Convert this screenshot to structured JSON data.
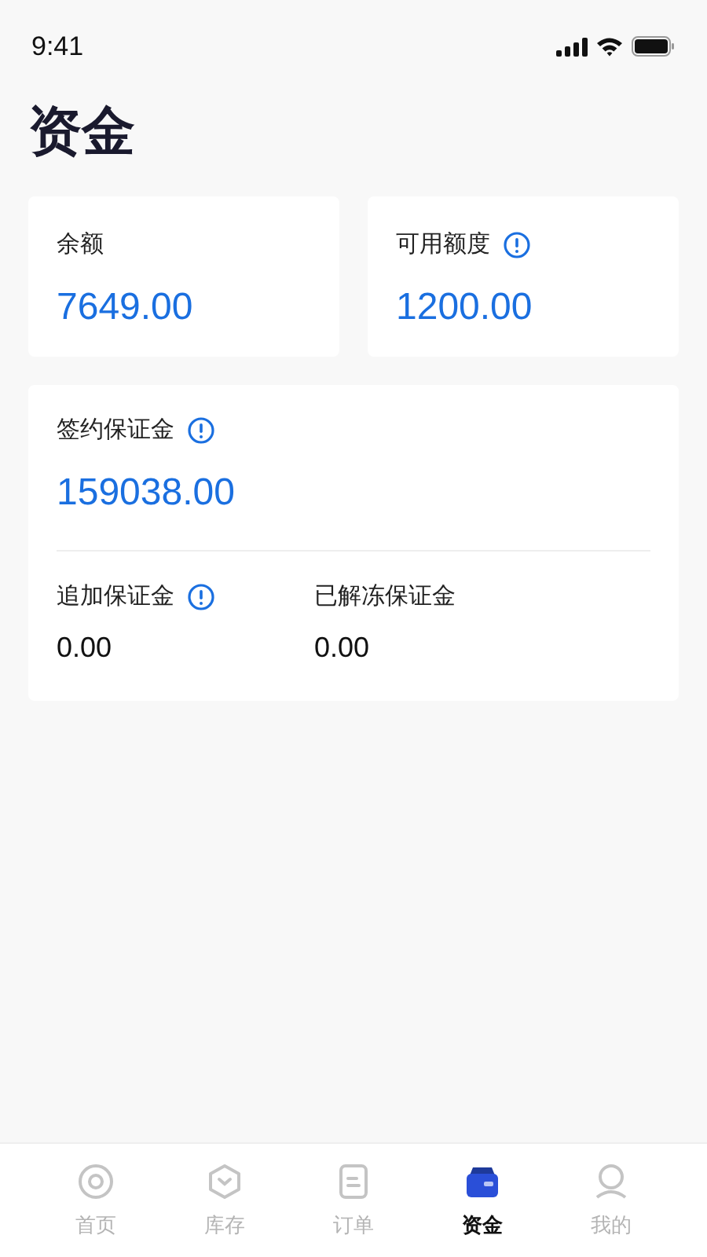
{
  "status_bar": {
    "time": "9:41"
  },
  "title": "资金",
  "top_cards": [
    {
      "label": "余额",
      "info": false,
      "value": "7649.00"
    },
    {
      "label": "可用额度",
      "info": true,
      "value": "1200.00"
    }
  ],
  "deposit_card": {
    "label": "签约保证金",
    "info": true,
    "value": "159038.00",
    "items": [
      {
        "label": "追加保证金",
        "info": true,
        "value": "0.00"
      },
      {
        "label": "已解冻保证金",
        "info": false,
        "value": "0.00"
      }
    ]
  },
  "tabs": [
    {
      "label": "首页",
      "kind": "home",
      "selected": false
    },
    {
      "label": "库存",
      "kind": "stock",
      "selected": false
    },
    {
      "label": "订单",
      "kind": "order",
      "selected": false
    },
    {
      "label": "资金",
      "kind": "wallet",
      "selected": true
    },
    {
      "label": "我的",
      "kind": "me",
      "selected": false
    }
  ]
}
